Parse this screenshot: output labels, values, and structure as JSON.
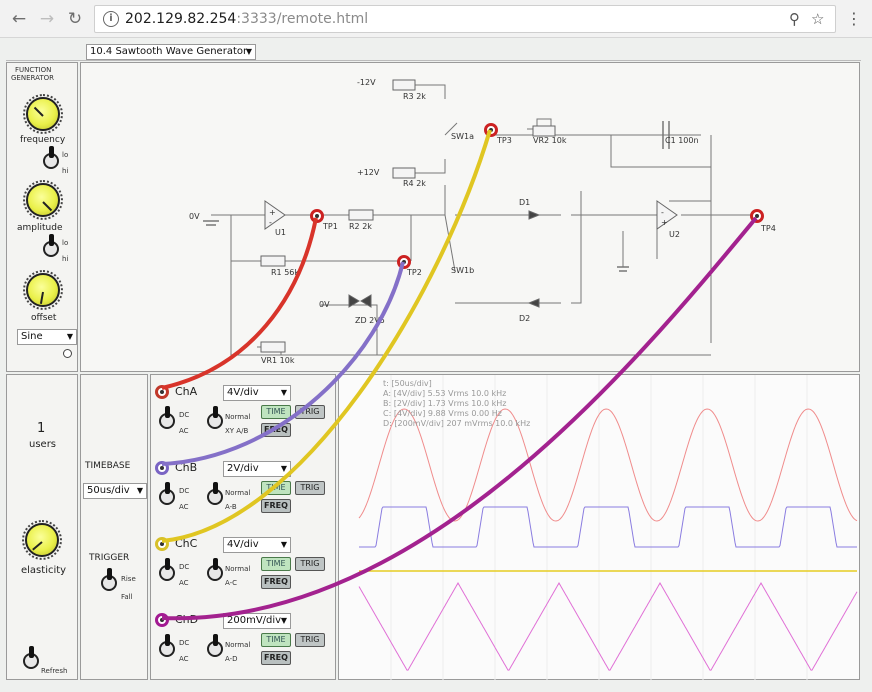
{
  "browser": {
    "url_host": "202.129.82.254",
    "url_port": ":3333",
    "url_path": "/remote.html"
  },
  "experiment_select": "10.4 Sawtooth Wave Generator",
  "function_generator": {
    "title_line1": "FUNCTION",
    "title_line2": "GENERATOR",
    "frequency_label": "frequency",
    "amplitude_label": "amplitude",
    "offset_label": "offset",
    "lo": "lo",
    "hi": "hi",
    "waveform": "Sine"
  },
  "circuit": {
    "minus12": "-12V",
    "plus12": "+12V",
    "r3": "R3 2k",
    "r4": "R4 2k",
    "sw1a": "SW1a",
    "sw1b": "SW1b",
    "tp1": "TP1",
    "tp2": "TP2",
    "tp3": "TP3",
    "tp4": "TP4",
    "vr2": "VR2 10k",
    "c1": "C1 100n",
    "zero_v": "0V",
    "zero_v2": "0V",
    "u1": "U1",
    "u2": "U2",
    "r2": "R2 2k",
    "r1": "R1 56k",
    "d1": "D1",
    "d2": "D2",
    "zd": "ZD 2V5",
    "vr1": "VR1 10k",
    "plus_a": "+",
    "minus_a": "-",
    "plus_b": "+",
    "minus_b": "-"
  },
  "users": {
    "count": "1",
    "label": "users"
  },
  "elasticity_label": "elasticity",
  "refresh_label": "Refresh",
  "timebase": {
    "label": "TIMEBASE",
    "value": "50us/div"
  },
  "trigger": {
    "label": "TRIGGER",
    "rise": "Rise",
    "fall": "Fall"
  },
  "channels": [
    {
      "name": "ChA",
      "div": "4V/div",
      "dc": "DC",
      "ac": "AC",
      "mode1": "Normal",
      "mode2": "XY A/B",
      "color": "#c0392b"
    },
    {
      "name": "ChB",
      "div": "2V/div",
      "dc": "DC",
      "ac": "AC",
      "mode1": "Normal",
      "mode2": "A-B",
      "color": "#7a64c4"
    },
    {
      "name": "ChC",
      "div": "4V/div",
      "dc": "DC",
      "ac": "AC",
      "mode1": "Normal",
      "mode2": "A-C",
      "color": "#d7c02a"
    },
    {
      "name": "ChD",
      "div": "200mV/div",
      "dc": "DC",
      "ac": "AC",
      "mode1": "Normal",
      "mode2": "A-D",
      "color": "#a21a92"
    }
  ],
  "buttons": {
    "time": "TIME",
    "trig": "TRIG",
    "freq": "FREQ"
  },
  "scope_readout": {
    "t": "t: [50us/div]",
    "a": "A:  [4V/div]  5.53 Vrms  10.0 kHz",
    "b": "B:  [2V/div]  1.73 Vrms  10.0 kHz",
    "c": "C:  [4V/div]  9.88 Vrms  0.00 Hz",
    "d": "D:  [200mV/div]  207 mVrms  10.0 kHz"
  },
  "colors": {
    "traceA": "#f08c8c",
    "traceB": "#8a7ce0",
    "traceC": "#e6cc22",
    "traceD": "#e070d6",
    "wireA": "#d8342a",
    "wireB": "#8470c8",
    "wireC": "#e0c622",
    "wireD": "#a3228f"
  }
}
